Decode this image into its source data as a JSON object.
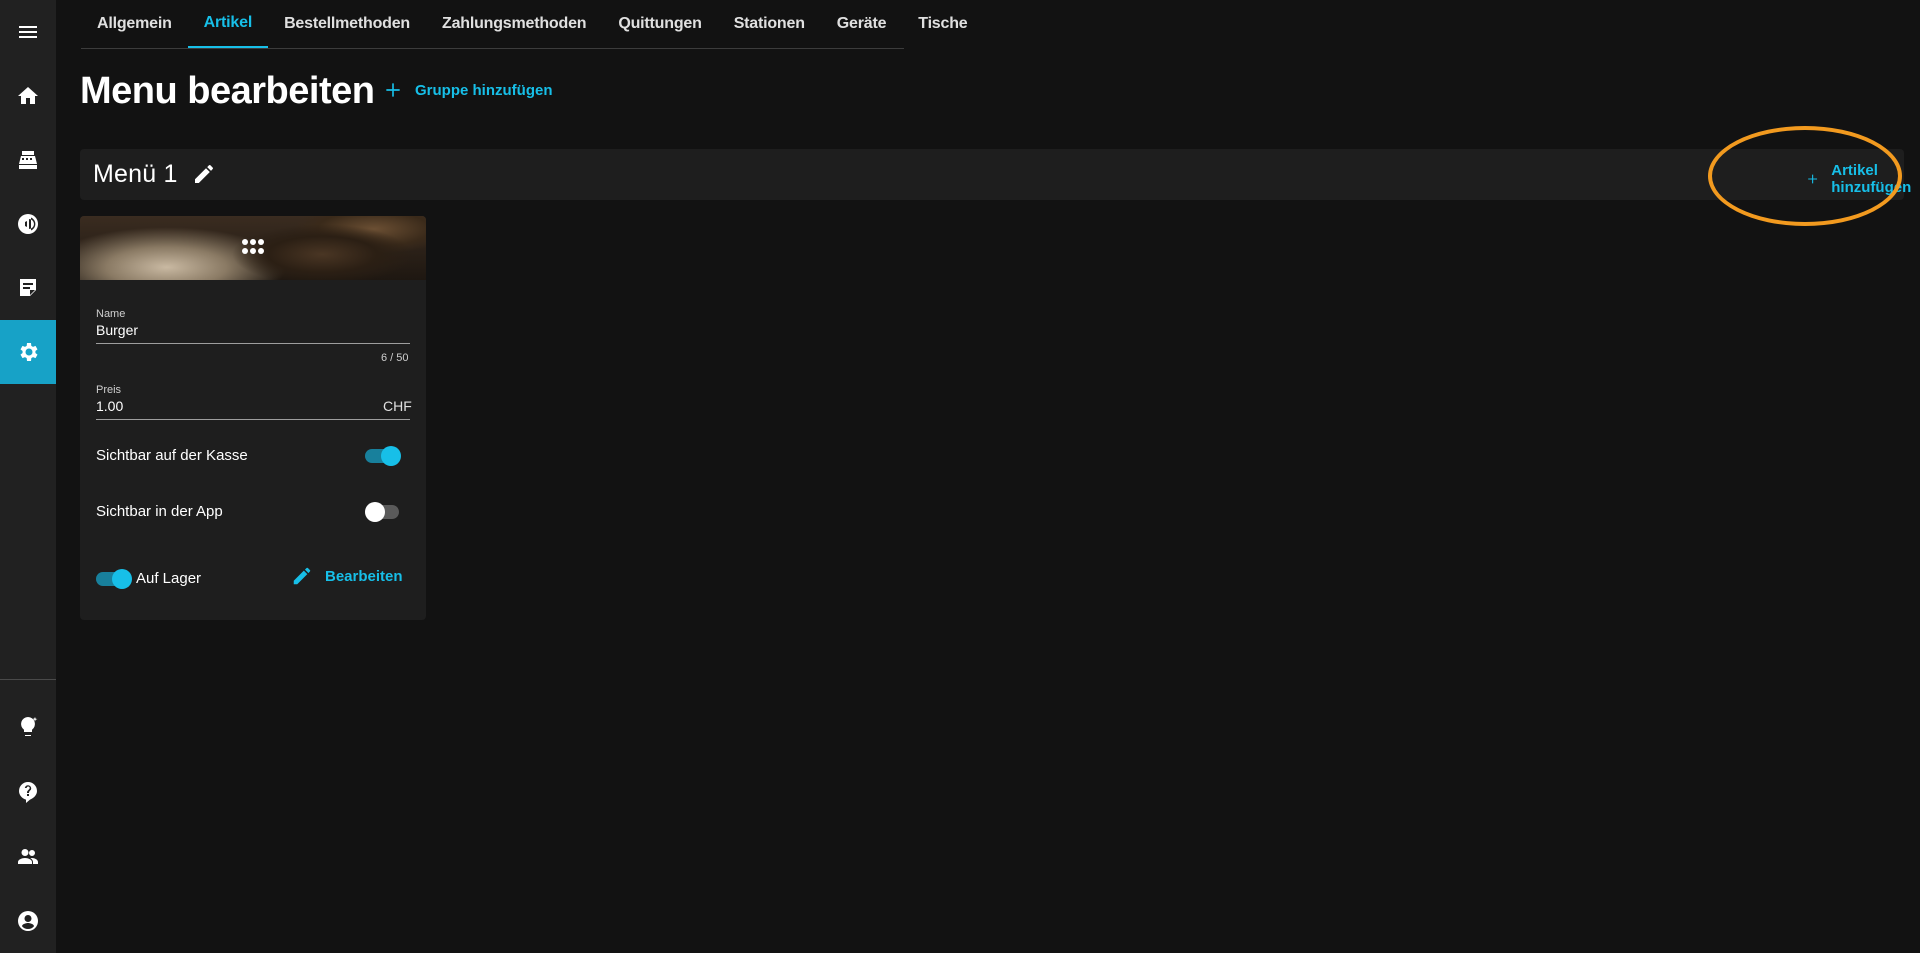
{
  "sidebar": {
    "items": [
      {
        "name": "menu-icon"
      },
      {
        "name": "home-icon"
      },
      {
        "name": "cash-register-icon"
      },
      {
        "name": "nfc-icon"
      },
      {
        "name": "orders-icon"
      },
      {
        "name": "settings-icon",
        "active": true
      },
      {
        "name": "lightbulb-icon"
      },
      {
        "name": "help-icon"
      },
      {
        "name": "users-icon"
      },
      {
        "name": "account-icon"
      }
    ]
  },
  "tabs": [
    {
      "label": "Allgemein"
    },
    {
      "label": "Artikel",
      "active": true
    },
    {
      "label": "Bestellmethoden"
    },
    {
      "label": "Zahlungsmethoden"
    },
    {
      "label": "Quittungen"
    },
    {
      "label": "Stationen"
    },
    {
      "label": "Geräte"
    },
    {
      "label": "Tische"
    }
  ],
  "header": {
    "title": "Menu bearbeiten",
    "add_group_label": "Gruppe hinzufügen"
  },
  "group": {
    "title": "Menü 1",
    "add_article_label": "Artikel hinzufügen"
  },
  "card": {
    "name_label": "Name",
    "name_value": "Burger",
    "name_counter": "6 / 50",
    "price_label": "Preis",
    "price_value": "1.00",
    "currency": "CHF",
    "visible_pos_label": "Sichtbar auf der Kasse",
    "visible_pos": true,
    "visible_app_label": "Sichtbar in der App",
    "visible_app": false,
    "in_stock_label": "Auf Lager",
    "in_stock": true,
    "edit_label": "Bearbeiten"
  },
  "colors": {
    "accent": "#17bfe8",
    "sidebar_active": "#17a2c7",
    "highlight_ring": "#f29a1f",
    "background": "#121212",
    "surface": "#1e1e1e"
  }
}
